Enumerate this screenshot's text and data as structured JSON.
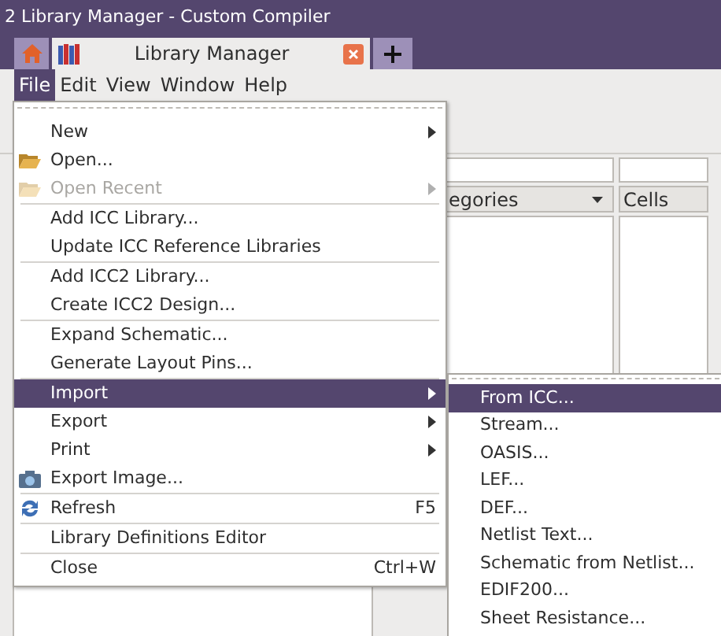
{
  "window": {
    "title": "2 Library Manager - Custom Compiler"
  },
  "tabs": [
    {
      "label": "Library Manager",
      "selected": true
    }
  ],
  "menu_bar": [
    {
      "label": "File",
      "selected": true
    },
    {
      "label": "Edit",
      "selected": false
    },
    {
      "label": "View",
      "selected": false
    },
    {
      "label": "Window",
      "selected": false
    },
    {
      "label": "Help",
      "selected": false
    }
  ],
  "panels": {
    "column_2_header": "egories",
    "column_3_header": "Cells"
  },
  "file_menu": [
    {
      "kind": "item",
      "label": "New",
      "submenu": true,
      "disabled": false,
      "selected": false
    },
    {
      "kind": "folder",
      "label": "Open...",
      "disabled": false,
      "selected": false
    },
    {
      "kind": "folder",
      "label": "Open Recent",
      "submenu": true,
      "disabled": true,
      "selected": false
    },
    {
      "kind": "separator"
    },
    {
      "kind": "item",
      "label": "Add ICC Library...",
      "disabled": false,
      "selected": false
    },
    {
      "kind": "item",
      "label": "Update ICC Reference Libraries",
      "disabled": false,
      "selected": false
    },
    {
      "kind": "separator"
    },
    {
      "kind": "item",
      "label": "Add ICC2 Library...",
      "disabled": false,
      "selected": false
    },
    {
      "kind": "item",
      "label": "Create ICC2 Design...",
      "disabled": false,
      "selected": false
    },
    {
      "kind": "separator"
    },
    {
      "kind": "item",
      "label": "Expand Schematic...",
      "disabled": false,
      "selected": false
    },
    {
      "kind": "item",
      "label": "Generate Layout Pins...",
      "disabled": false,
      "selected": false
    },
    {
      "kind": "separator"
    },
    {
      "kind": "item",
      "label": "Import",
      "submenu": true,
      "disabled": false,
      "selected": true
    },
    {
      "kind": "item",
      "label": "Export",
      "submenu": true,
      "disabled": false,
      "selected": false
    },
    {
      "kind": "item",
      "label": "Print",
      "submenu": true,
      "disabled": false,
      "selected": false
    },
    {
      "kind": "camera",
      "label": "Export Image...",
      "disabled": false,
      "selected": false
    },
    {
      "kind": "separator"
    },
    {
      "kind": "refresh",
      "label": "Refresh",
      "shortcut": "F5",
      "disabled": false,
      "selected": false
    },
    {
      "kind": "separator"
    },
    {
      "kind": "item",
      "label": "Library Definitions Editor",
      "disabled": false,
      "selected": false
    },
    {
      "kind": "separator"
    },
    {
      "kind": "item",
      "label": "Close",
      "shortcut": "Ctrl+W",
      "disabled": false,
      "selected": false
    }
  ],
  "import_submenu": [
    {
      "label": "From ICC...",
      "selected": true
    },
    {
      "label": "Stream...",
      "selected": false
    },
    {
      "label": "OASIS...",
      "selected": false
    },
    {
      "label": "LEF...",
      "selected": false
    },
    {
      "label": "DEF...",
      "selected": false
    },
    {
      "label": "Netlist Text...",
      "selected": false
    },
    {
      "label": "Schematic from Netlist...",
      "selected": false
    },
    {
      "label": "EDIF200...",
      "selected": false
    },
    {
      "label": "Sheet Resistance...",
      "selected": false
    }
  ]
}
